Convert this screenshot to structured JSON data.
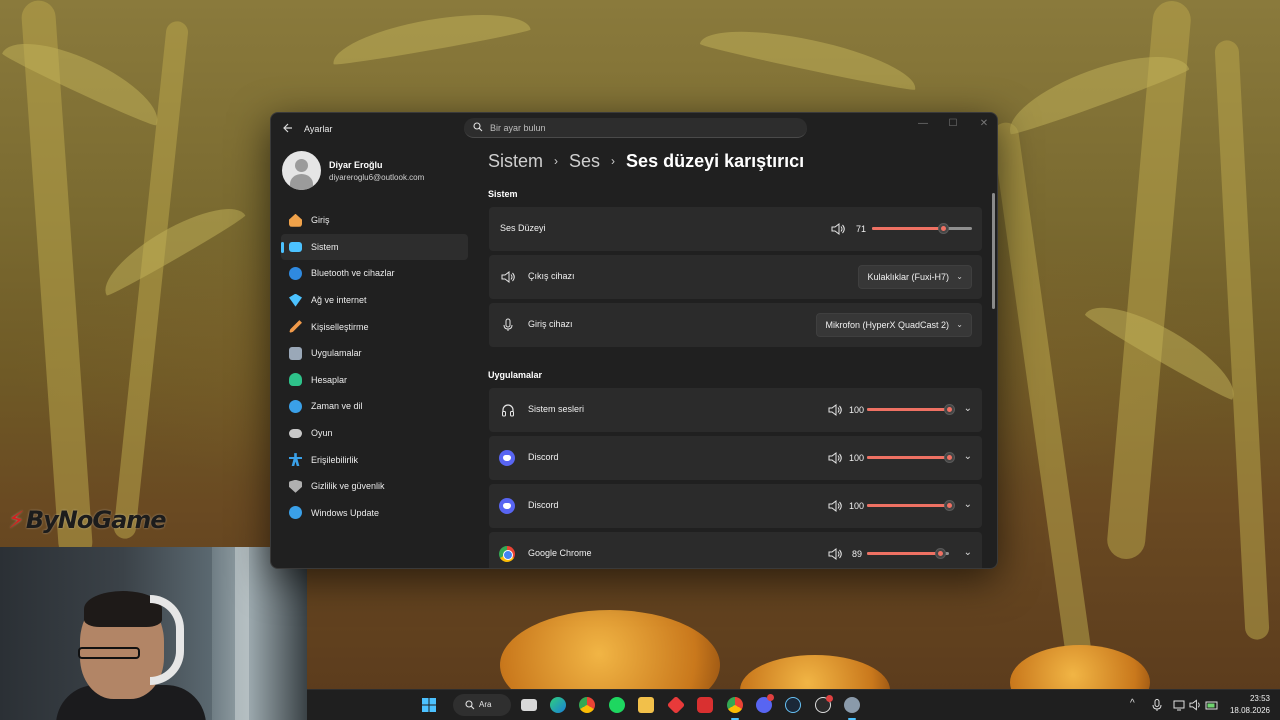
{
  "watermark": {
    "brand": "ByNoGame"
  },
  "window": {
    "app_title": "Ayarlar",
    "search": {
      "placeholder": "Bir ayar bulun"
    },
    "controls": {
      "minimize": "—",
      "maximize": "☐",
      "close": "✕"
    }
  },
  "profile": {
    "name": "Diyar Eroğlu",
    "email": "diyareroglu6@outlook.com"
  },
  "sidebar": {
    "items": [
      {
        "label": "Giriş",
        "icon": "home-icon",
        "color": "#f0a24a"
      },
      {
        "label": "Sistem",
        "icon": "system-icon",
        "color": "#4cc2ff",
        "active": true
      },
      {
        "label": "Bluetooth ve cihazlar",
        "icon": "bluetooth-icon",
        "color": "#2f8ae0"
      },
      {
        "label": "Ağ ve internet",
        "icon": "network-icon",
        "color": "#4cc2ff"
      },
      {
        "label": "Kişiselleştirme",
        "icon": "brush-icon",
        "color": "#f09a4a"
      },
      {
        "label": "Uygulamalar",
        "icon": "apps-icon",
        "color": "#9aa8b8"
      },
      {
        "label": "Hesaplar",
        "icon": "accounts-icon",
        "color": "#2ec28a"
      },
      {
        "label": "Zaman ve dil",
        "icon": "globe-icon",
        "color": "#3aa0e8"
      },
      {
        "label": "Oyun",
        "icon": "gamepad-icon",
        "color": "#c8c8c8"
      },
      {
        "label": "Erişilebilirlik",
        "icon": "accessibility-icon",
        "color": "#3aa0e8"
      },
      {
        "label": "Gizlilik ve güvenlik",
        "icon": "shield-icon",
        "color": "#b0b0b0"
      },
      {
        "label": "Windows Update",
        "icon": "update-icon",
        "color": "#3aa0e8"
      }
    ]
  },
  "breadcrumb": {
    "part1": "Sistem",
    "part2": "Ses",
    "current": "Ses düzeyi karıştırıcı",
    "separator": "›"
  },
  "system_section": {
    "title": "Sistem",
    "volume": {
      "label": "Ses Düzeyi",
      "value": "71",
      "level": 71
    },
    "output": {
      "label": "Çıkış cihazı",
      "selected": "Kulaklıklar (Fuxi-H7)"
    },
    "input": {
      "label": "Giriş cihazı",
      "selected": "Mikrofon (HyperX QuadCast 2)"
    }
  },
  "apps_section": {
    "title": "Uygulamalar",
    "apps": [
      {
        "name": "Sistem sesleri",
        "value": "100",
        "level": 100,
        "icon": "headphones-icon"
      },
      {
        "name": "Discord",
        "value": "100",
        "level": 100,
        "icon": "discord-icon"
      },
      {
        "name": "Discord",
        "value": "100",
        "level": 100,
        "icon": "discord-icon"
      },
      {
        "name": "Google Chrome",
        "value": "89",
        "level": 89,
        "icon": "chrome-icon"
      }
    ]
  },
  "taskbar": {
    "search_label": "Ara",
    "time": "23:53",
    "date": "18.08.2026",
    "chevron": "^"
  }
}
